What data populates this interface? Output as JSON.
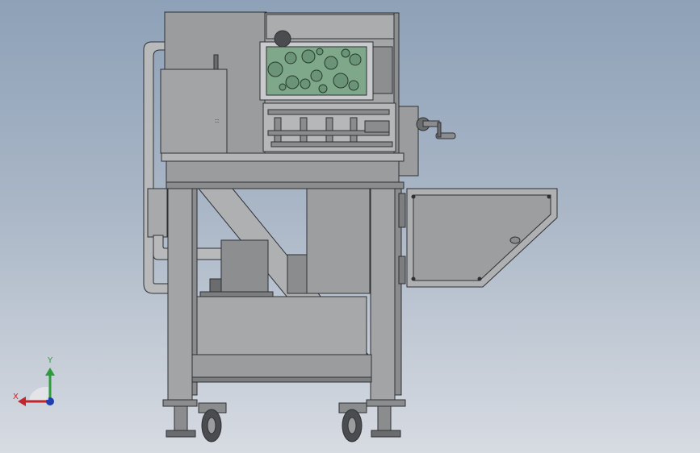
{
  "colors": {
    "background_top": "#8ea1b8",
    "background_bottom": "#d7dbe2",
    "steel_fill": "#9a9c9e",
    "steel_light": "#b3b5b7",
    "edge": "#2e3034",
    "pcb_green": "#7fa88a",
    "axis_x": "#c0262c",
    "axis_y": "#2e9c3c",
    "axis_z": "#1f3fb0"
  },
  "axes": {
    "x_label": "X",
    "y_label": "Y"
  },
  "icons": {
    "orientation_triad": "xyz-triad-icon",
    "handwheel": "handwheel-icon",
    "caster": "caster-wheel-icon"
  }
}
